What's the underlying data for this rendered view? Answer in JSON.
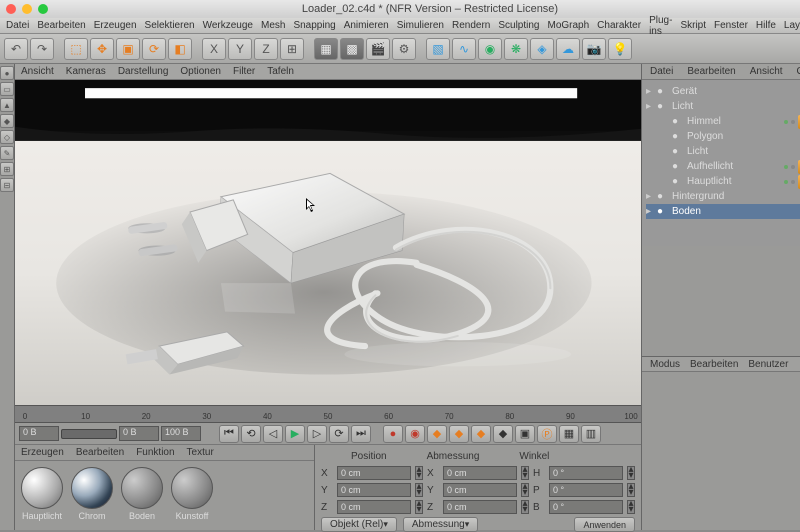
{
  "title": "Loader_02.c4d * (NFR Version – Restricted License)",
  "menu": [
    "Datei",
    "Bearbeiten",
    "Erzeugen",
    "Selektieren",
    "Werkzeuge",
    "Mesh",
    "Snapping",
    "Animieren",
    "Simulieren",
    "Rendern",
    "Sculpting",
    "MoGraph",
    "Charakter",
    "Plug-ins",
    "Skript",
    "Fenster",
    "Hilfe",
    "Layout:"
  ],
  "viewTabs": [
    "Ansicht",
    "Kameras",
    "Darstellung",
    "Optionen",
    "Filter",
    "Tafeln"
  ],
  "rightTabs": [
    "Datei",
    "Bearbeiten",
    "Ansicht",
    "Objekte"
  ],
  "attrTabs": [
    "Modus",
    "Bearbeiten",
    "Benutzer"
  ],
  "tree": [
    {
      "label": "Gerät",
      "lvl": 0,
      "icon": "cube"
    },
    {
      "label": "Licht",
      "lvl": 0,
      "icon": "null"
    },
    {
      "label": "Himmel",
      "lvl": 1,
      "icon": "sky"
    },
    {
      "label": "Polygon",
      "lvl": 1,
      "icon": "poly"
    },
    {
      "label": "Licht",
      "lvl": 1,
      "icon": "light"
    },
    {
      "label": "Aufhellicht",
      "lvl": 1,
      "icon": "light"
    },
    {
      "label": "Hauptlicht",
      "lvl": 1,
      "icon": "light"
    },
    {
      "label": "Hintergrund",
      "lvl": 0,
      "icon": "bg"
    },
    {
      "label": "Boden",
      "lvl": 0,
      "icon": "floor",
      "sel": true
    }
  ],
  "materials": {
    "tabs": [
      "Erzeugen",
      "Bearbeiten",
      "Funktion",
      "Textur"
    ],
    "items": [
      {
        "label": "Hauptlicht",
        "class": ""
      },
      {
        "label": "Chrom",
        "class": "chrome"
      },
      {
        "label": "Boden",
        "class": "grey"
      },
      {
        "label": "Kunstoff",
        "class": "grey"
      }
    ]
  },
  "coords": {
    "headers": [
      "Position",
      "Abmessung",
      "Winkel"
    ],
    "rows": [
      {
        "axis": "X",
        "pos": "0 cm",
        "dim": "0 cm",
        "ang": "0 °",
        "alab": "H"
      },
      {
        "axis": "Y",
        "pos": "0 cm",
        "dim": "0 cm",
        "ang": "0 °",
        "alab": "P"
      },
      {
        "axis": "Z",
        "pos": "0 cm",
        "dim": "0 cm",
        "ang": "0 °",
        "alab": "B"
      }
    ],
    "mode": "Objekt (Rel)",
    "dimMode": "Abmessung",
    "apply": "Anwenden"
  },
  "timeline": {
    "ticks": [
      "0",
      "10",
      "20",
      "30",
      "40",
      "50",
      "60",
      "70",
      "80",
      "90",
      "100"
    ]
  },
  "frame": {
    "start": "0 B",
    "cur": "0 B",
    "end": "100 B"
  },
  "toolbar": [
    {
      "name": "undo",
      "ch": "↶",
      "cls": ""
    },
    {
      "name": "redo",
      "ch": "↷",
      "cls": ""
    },
    {
      "sep": 1
    },
    {
      "name": "live-select",
      "ch": "⬚",
      "cls": "orange"
    },
    {
      "name": "move",
      "ch": "✥",
      "cls": "orange"
    },
    {
      "name": "scale",
      "ch": "▣",
      "cls": "orange"
    },
    {
      "name": "rotate",
      "ch": "⟳",
      "cls": "orange"
    },
    {
      "name": "recent",
      "ch": "◧",
      "cls": "orange"
    },
    {
      "sep": 1
    },
    {
      "name": "x-axis",
      "ch": "X",
      "cls": ""
    },
    {
      "name": "y-axis",
      "ch": "Y",
      "cls": ""
    },
    {
      "name": "z-axis",
      "ch": "Z",
      "cls": ""
    },
    {
      "name": "coord-sys",
      "ch": "⊞",
      "cls": ""
    },
    {
      "sep": 1
    },
    {
      "name": "render-view",
      "ch": "▦",
      "cls": "dark"
    },
    {
      "name": "render-region",
      "ch": "▩",
      "cls": "dark"
    },
    {
      "name": "render-settings",
      "ch": "🎬",
      "cls": ""
    },
    {
      "name": "render-pic",
      "ch": "⚙",
      "cls": ""
    },
    {
      "sep": 1
    },
    {
      "name": "cube",
      "ch": "▧",
      "cls": "blue"
    },
    {
      "name": "spline",
      "ch": "∿",
      "cls": "blue"
    },
    {
      "name": "nurbs",
      "ch": "◉",
      "cls": "green"
    },
    {
      "name": "array",
      "ch": "❋",
      "cls": "green"
    },
    {
      "name": "deformer",
      "ch": "◈",
      "cls": "blue"
    },
    {
      "name": "environment",
      "ch": "☁",
      "cls": "blue"
    },
    {
      "name": "camera",
      "ch": "📷",
      "cls": ""
    },
    {
      "name": "light",
      "ch": "💡",
      "cls": ""
    }
  ],
  "playbar": [
    {
      "name": "go-start",
      "ch": "⏮"
    },
    {
      "name": "prev-key",
      "ch": "⟲"
    },
    {
      "name": "prev-frame",
      "ch": "◁"
    },
    {
      "name": "play",
      "ch": "▶",
      "cls": "green"
    },
    {
      "name": "next-frame",
      "ch": "▷"
    },
    {
      "name": "next-key",
      "ch": "⟳"
    },
    {
      "name": "go-end",
      "ch": "⏭"
    },
    {
      "sep": 1
    },
    {
      "name": "record",
      "ch": "●",
      "cls": "red"
    },
    {
      "name": "autokey",
      "ch": "◉",
      "cls": "red"
    },
    {
      "name": "key-pos",
      "ch": "◆",
      "cls": "orange"
    },
    {
      "name": "key-scale",
      "ch": "◆",
      "cls": "orange"
    },
    {
      "name": "key-rot",
      "ch": "◆",
      "cls": "orange"
    },
    {
      "name": "key-pla",
      "ch": "◆",
      "cls": ""
    },
    {
      "name": "key-opt1",
      "ch": "▣"
    },
    {
      "name": "key-opt2",
      "ch": "Ⓟ",
      "cls": "orange"
    },
    {
      "name": "key-opt3",
      "ch": "▦"
    },
    {
      "name": "key-opt4",
      "ch": "▥"
    }
  ]
}
